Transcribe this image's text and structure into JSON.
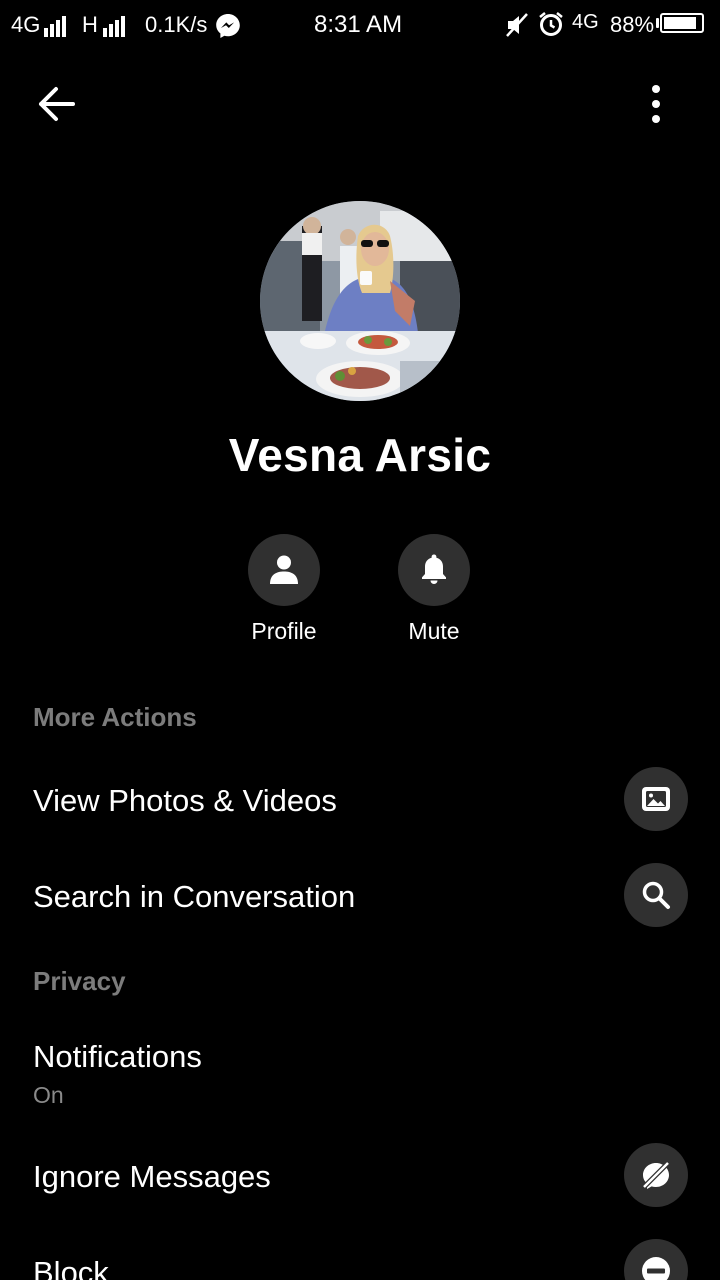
{
  "status_bar": {
    "network1": "4G",
    "network2": "H",
    "speed": "0.1K/s",
    "time": "8:31 AM",
    "network3": "4G",
    "battery": "88%",
    "battery_level": 0.88,
    "icons": [
      "signal-icon",
      "messenger-icon",
      "mute-icon",
      "alarm-icon",
      "battery-icon"
    ]
  },
  "header": {
    "back_icon": "arrow-left-icon",
    "menu_icon": "more-vertical-icon"
  },
  "contact": {
    "name": "Vesna Arsic"
  },
  "quick_actions": [
    {
      "label": "Profile",
      "icon": "person-icon"
    },
    {
      "label": "Mute",
      "icon": "bell-icon"
    }
  ],
  "sections": {
    "more_actions": {
      "title": "More Actions",
      "items": [
        {
          "label": "View Photos & Videos",
          "icon": "image-icon"
        },
        {
          "label": "Search in Conversation",
          "icon": "search-icon"
        }
      ]
    },
    "privacy": {
      "title": "Privacy",
      "items": [
        {
          "label": "Notifications",
          "sublabel": "On"
        },
        {
          "label": "Ignore Messages",
          "icon": "ignore-icon"
        },
        {
          "label": "Block",
          "icon": "block-icon"
        }
      ]
    }
  },
  "colors": {
    "background": "#000000",
    "button_bg": "#303030",
    "section_title": "#7c7c7c",
    "sublabel": "#8a8a8a"
  }
}
